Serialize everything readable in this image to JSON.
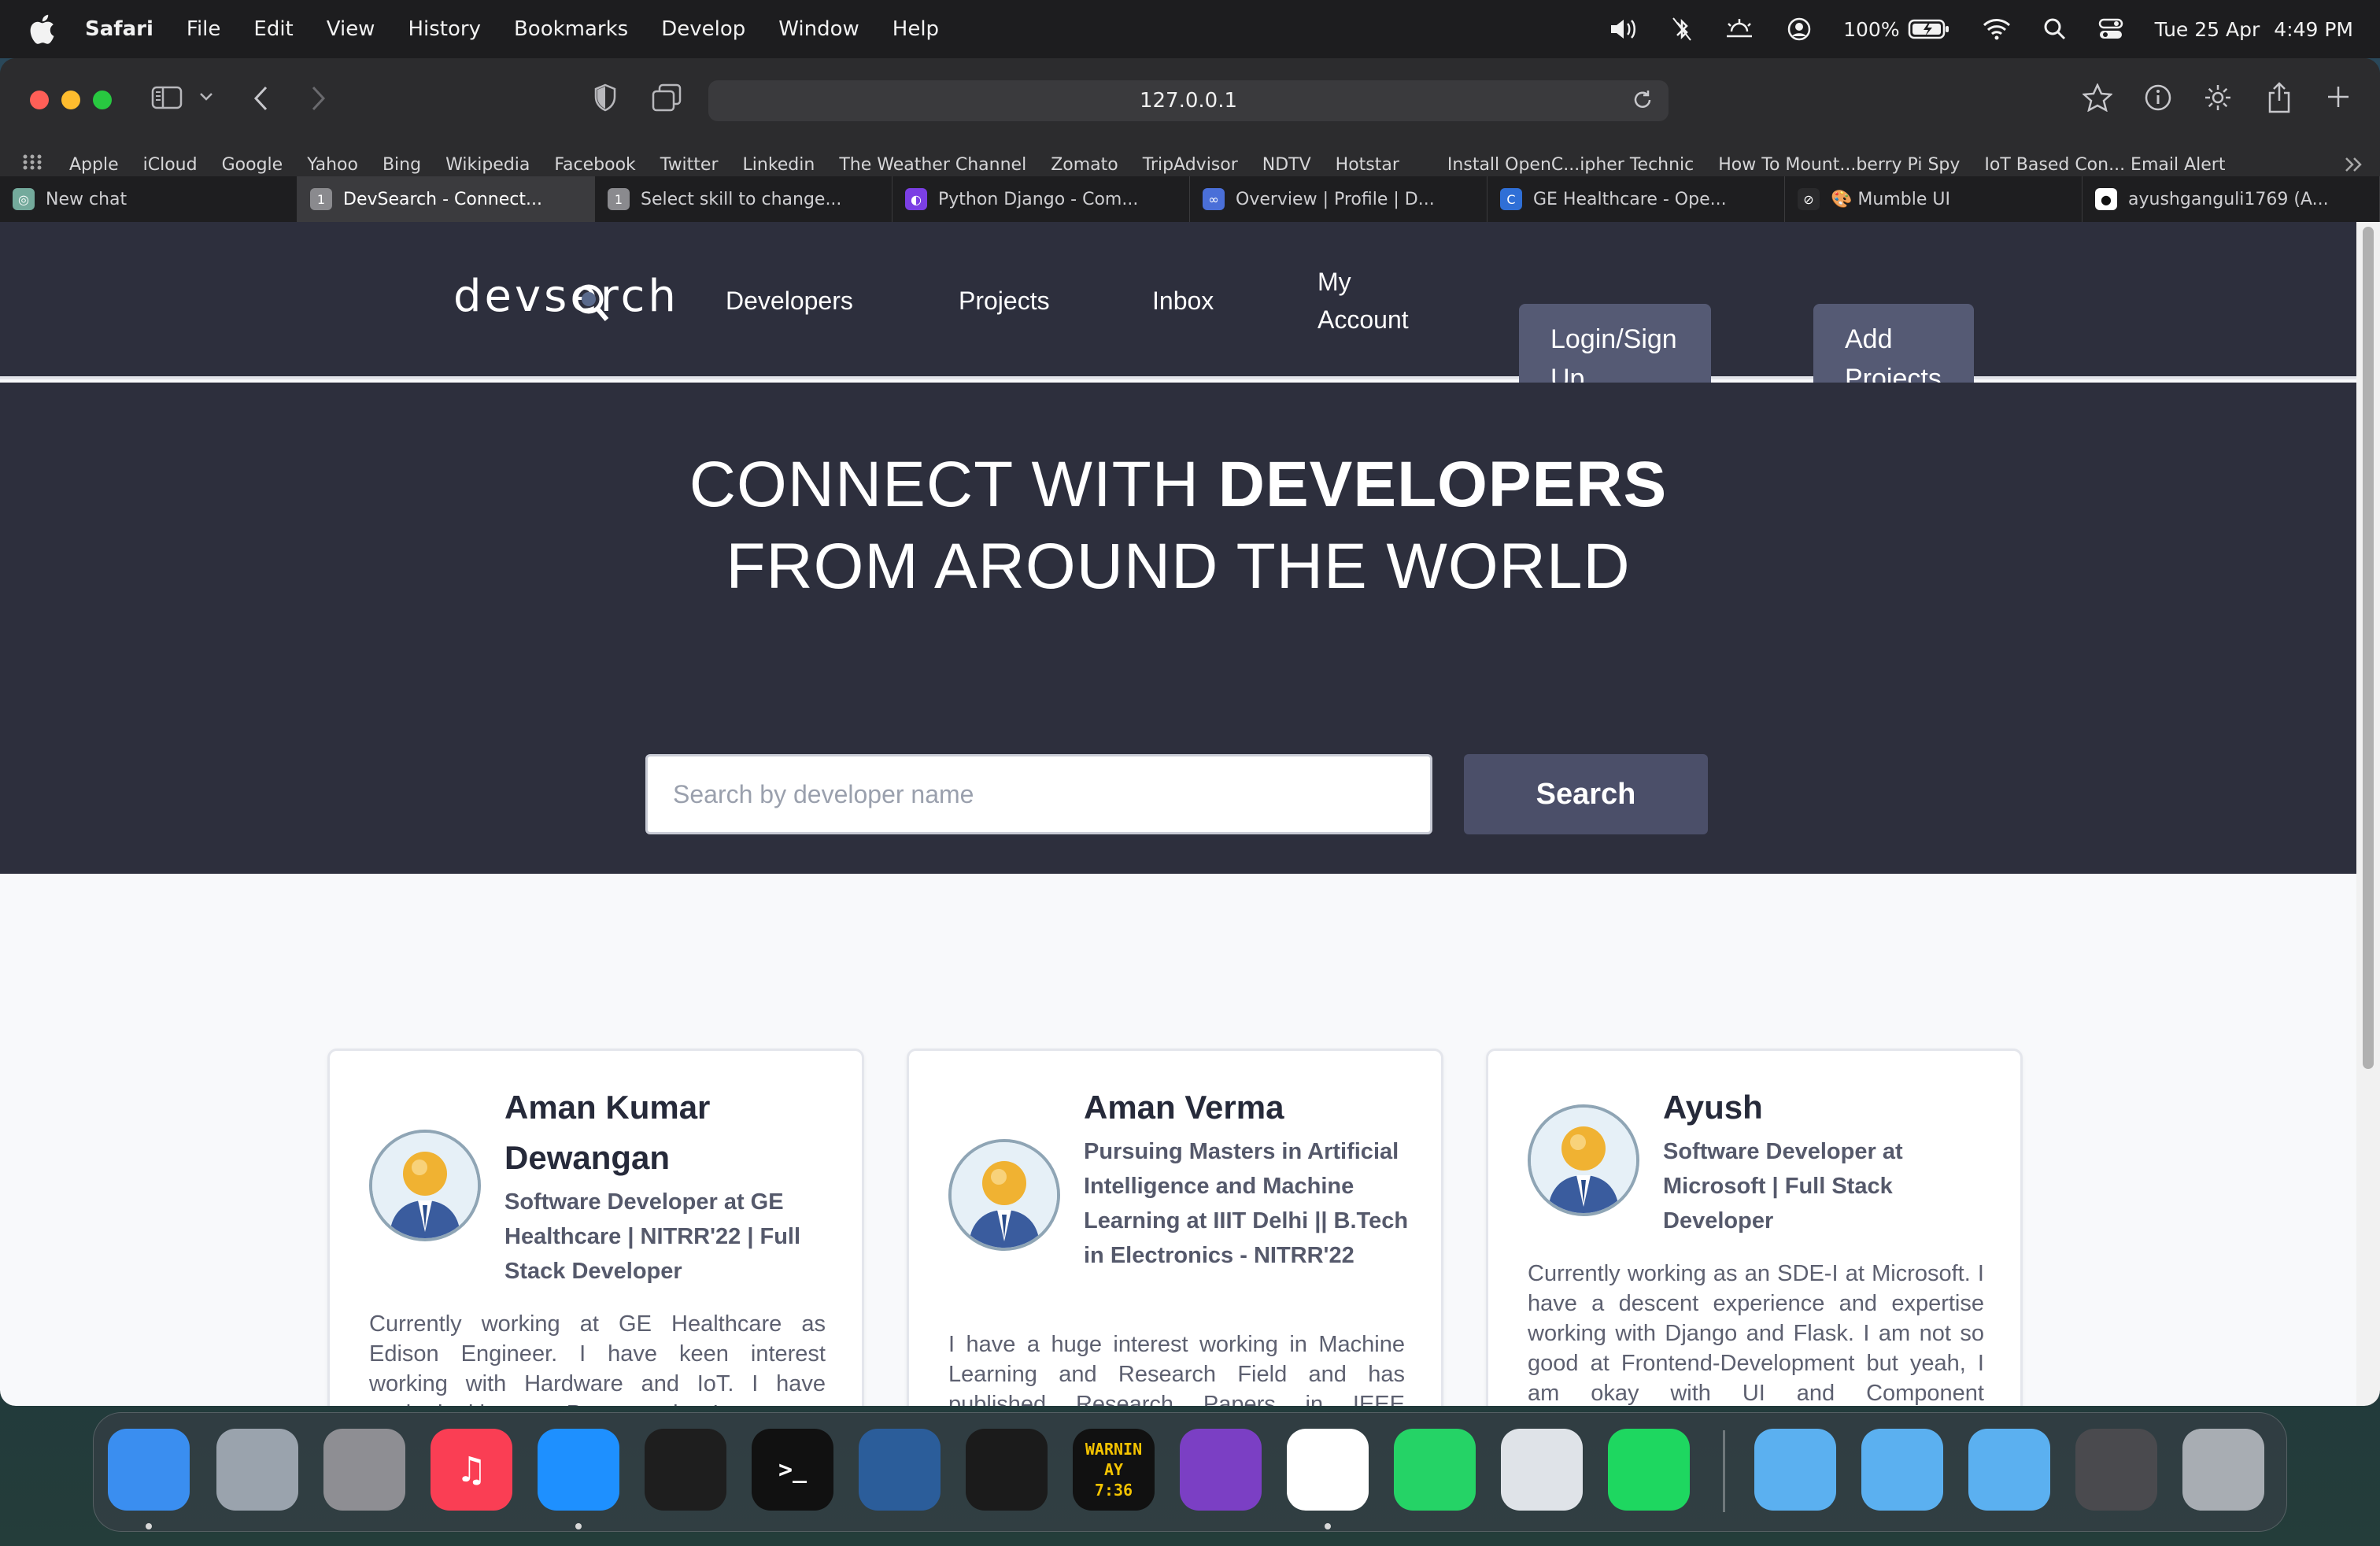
{
  "menubar": {
    "app": "Safari",
    "items": [
      "File",
      "Edit",
      "View",
      "History",
      "Bookmarks",
      "Develop",
      "Window",
      "Help"
    ],
    "battery": "100%",
    "date": "Tue 25 Apr",
    "time": "4:49 PM"
  },
  "browser": {
    "url": "127.0.0.1",
    "bookmarks": [
      "Apple",
      "iCloud",
      "Google",
      "Yahoo",
      "Bing",
      "Wikipedia",
      "Facebook",
      "Twitter",
      "Linkedin",
      "The Weather Channel",
      "Zomato",
      "TripAdvisor",
      "NDTV",
      "Hotstar",
      "Install OpenC...ipher Technic",
      "How To Mount...berry Pi Spy",
      "IoT Based Con... Email Alert"
    ],
    "tabs": [
      {
        "label": "New chat",
        "icon": "chatgpt-icon",
        "color": "#74aa9c",
        "glyph": "◎",
        "active": false
      },
      {
        "label": "DevSearch - Connect...",
        "icon": "numbered-tab-icon",
        "color": "#8a8a8e",
        "glyph": "1",
        "active": true
      },
      {
        "label": "Select skill to change...",
        "icon": "numbered-tab-icon",
        "color": "#8a8a8e",
        "glyph": "1",
        "active": false
      },
      {
        "label": "Python Django - Com...",
        "icon": "purple-app-icon",
        "color": "#7b3fe4",
        "glyph": "◐",
        "active": false
      },
      {
        "label": "Overview | Profile | D...",
        "icon": "binoculars-icon",
        "color": "#4a6fd8",
        "glyph": "∞",
        "active": false
      },
      {
        "label": "GE Healthcare - Ope...",
        "icon": "ge-icon",
        "color": "#2f6fd6",
        "glyph": "C",
        "active": false
      },
      {
        "label": "🎨 Mumble UI",
        "icon": "compass-icon",
        "color": "#2a2a2c",
        "glyph": "⊘",
        "active": false
      },
      {
        "label": "ayushganguli1769 (A...",
        "icon": "github-icon",
        "color": "#ffffff",
        "glyph": "●",
        "active": false
      }
    ]
  },
  "site": {
    "logo": "devsearch",
    "nav": {
      "developers": "Developers",
      "projects": "Projects",
      "inbox": "Inbox",
      "my_account": "My Account",
      "login": "Login/Sign Up",
      "add_projects": "Add Projects"
    },
    "hero": {
      "line1_light": "CONNECT WITH ",
      "line1_bold": "DEVELOPERS",
      "line2": "FROM AROUND THE WORLD"
    },
    "search": {
      "placeholder": "Search by developer name",
      "button": "Search"
    },
    "developers": [
      {
        "name": "Aman Kumar Dewangan",
        "headline": "Software Developer at GE Healthcare | NITRR'22 | Full Stack Developer",
        "bio": "Currently working at GE Healthcare as Edison Engineer. I have keen interest working with Hardware and IoT. I have worked with many Programming Languages including C++, Java, Python,"
      },
      {
        "name": "Aman Verma",
        "headline": "Pursuing Masters in Artificial Intelligence and Machine Learning at IIIT Delhi || B.Tech in Electronics - NITRR'22",
        "bio": "I have a huge interest working in Machine Learning and Research Field and has published Research Papers in IEEE Conferences as well."
      },
      {
        "name": "Ayush",
        "headline": "Software Developer at Microsoft | Full Stack Developer",
        "bio": "Currently working as an SDE-I at Microsoft. I have a descent experience and expertise working with Django and Flask. I am not so good at Frontend-Development but yeah, I am okay with UI and Component Development. So, you can call me a Full Stack Developer at the"
      }
    ]
  },
  "dock": {
    "apps": [
      {
        "name": "finder-icon",
        "label": "",
        "color": "#3a8ef0"
      },
      {
        "name": "launchpad-icon",
        "label": "",
        "color": "#9aa3ad"
      },
      {
        "name": "system-settings-icon",
        "label": "",
        "color": "#8e8e93"
      },
      {
        "name": "music-icon",
        "label": "♫",
        "color": "#fa3e54"
      },
      {
        "name": "safari-icon",
        "label": "",
        "color": "#1e90ff"
      },
      {
        "name": "figma-icon",
        "label": "",
        "color": "#1e1e1e"
      },
      {
        "name": "terminal-icon",
        "label": ">_",
        "color": "#111111"
      },
      {
        "name": "azure-data-studio-icon",
        "label": "",
        "color": "#2b5d9a"
      },
      {
        "name": "activity-monitor-icon",
        "label": "",
        "color": "#1b1b1b"
      },
      {
        "name": "console-icon",
        "label": "WARNIN AY 7:36",
        "color": "#111111"
      },
      {
        "name": "github-desktop-icon",
        "label": "",
        "color": "#7b3fc4"
      },
      {
        "name": "vscode-icon",
        "label": "",
        "color": "#ffffff"
      },
      {
        "name": "whatsapp-icon",
        "label": "",
        "color": "#25d366"
      },
      {
        "name": "disk-utility-icon",
        "label": "",
        "color": "#dfe3e8"
      },
      {
        "name": "spotify-icon",
        "label": "",
        "color": "#1ed760"
      },
      {
        "name": "folder-icon",
        "label": "",
        "color": "#5bb0f0"
      },
      {
        "name": "home-folder-icon",
        "label": "",
        "color": "#5bb0f0"
      },
      {
        "name": "applications-folder-icon",
        "label": "",
        "color": "#5bb0f0"
      },
      {
        "name": "downloads-stack-icon",
        "label": "",
        "color": "#4a4a4e"
      },
      {
        "name": "trash-icon",
        "label": "",
        "color": "#a8adb3"
      }
    ]
  }
}
